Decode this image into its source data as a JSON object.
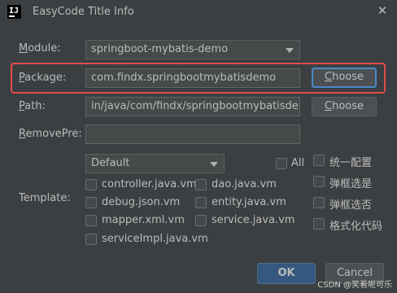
{
  "window": {
    "title": "EasyCode Title Info",
    "close_glyph": "✕"
  },
  "module": {
    "label": "Module:",
    "value": "springboot-mybatis-demo"
  },
  "package": {
    "label": "Package:",
    "value": "com.findx.springbootmybatisdemo",
    "button": "Choose"
  },
  "path": {
    "label": "Path:",
    "value": "in/java/com/findx/springbootmybatisdemo",
    "button": "Choose"
  },
  "remove_pre": {
    "label": "RemovePre:",
    "value": ""
  },
  "template": {
    "label": "Template:",
    "group": "Default",
    "all_label": "All",
    "items": [
      "controller.java.vm",
      "dao.java.vm",
      "debug.json.vm",
      "entity.java.vm",
      "mapper.xml.vm",
      "service.java.vm",
      "serviceImpl.java.vm"
    ]
  },
  "options": {
    "items": [
      "统一配置",
      "弹框选是",
      "弹框选否",
      "格式化代码"
    ]
  },
  "footer": {
    "ok": "OK",
    "cancel": "Cancel",
    "watermark": "CSDN @笑着呢可乐"
  },
  "icons": {
    "app": "intellij-icon",
    "dropdown": "chevron-down-icon"
  },
  "colors": {
    "background": "#3c3f41",
    "accent": "#4a88c7",
    "highlight": "#e04b4b",
    "primary_button": "#365880"
  }
}
